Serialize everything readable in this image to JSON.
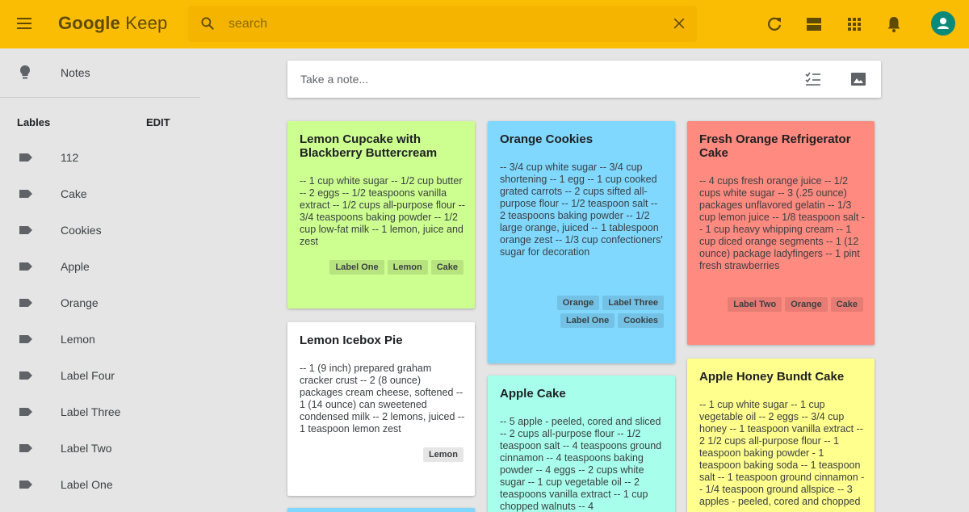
{
  "app": {
    "logo_strong": "Google",
    "logo_rest": " Keep"
  },
  "search": {
    "placeholder": "search"
  },
  "header_icons": [
    "menu-icon",
    "search-icon",
    "close-icon",
    "refresh-icon",
    "list-view-icon",
    "apps-icon",
    "bell-icon",
    "account-icon"
  ],
  "sidebar": {
    "notes_label": "Notes",
    "labels_heading": "Lables",
    "edit_label": "EDIT",
    "labels": [
      "112",
      "Cake",
      "Cookies",
      "Apple",
      "Orange",
      "Lemon",
      "Label Four",
      "Label Three",
      "Label Two",
      "Label One"
    ]
  },
  "take_note": {
    "placeholder": "Take a note..."
  },
  "colors": {
    "header": "#fbbc04",
    "green": "#ccff90",
    "blue": "#80d8ff",
    "red": "#ff8a80",
    "white": "#ffffff",
    "teal": "#a7ffeb",
    "yellow": "#ffff8d"
  },
  "notes": [
    {
      "title": "Lemon Cupcake with Blackberry Buttercream",
      "body": "-- 1 cup white sugar -- 1/2 cup butter -- 2 eggs -- 1/2 teaspoons vanilla extract -- 1/2 cups all-purpose flour -- 3/4 teaspoons baking powder -- 1/2 cup low-fat milk -- 1 lemon, juice and zest",
      "labels": [
        "Label One",
        "Lemon",
        "Cake"
      ]
    },
    {
      "title": "Lemon Icebox Pie",
      "body": "-- 1 (9 inch) prepared graham cracker crust -- 2 (8 ounce) packages cream cheese, softened -- 1 (14 ounce) can sweetened condensed milk -- 2 lemons, juiced -- 1 teaspoon lemon zest",
      "labels": [
        "Lemon"
      ]
    },
    {
      "title": "Orange Cookies",
      "body": "-- 3/4 cup white sugar -- 3/4 cup shortening -- 1 egg -- 1 cup cooked grated carrots -- 2 cups sifted all-purpose flour -- 1/2 teaspoon salt -- 2 teaspoons baking powder -- 1/2 large orange, juiced -- 1 tablespoon orange zest -- 1/3 cup confectioners' sugar for decoration",
      "labels": [
        "Orange",
        "Label Three",
        "Label One",
        "Cookies"
      ]
    },
    {
      "title": "Apple Cake",
      "body": "-- 5 apple - peeled, cored and sliced -- 2 cups all-purpose flour -- 1/2 teaspoon salt -- 4 teaspoons ground cinnamon -- 4 teaspoons baking powder -- 4 eggs -- 2 cups white sugar -- 1 cup vegetable oil -- 2 teaspoons vanilla extract -- 1 cup chopped walnuts -- 4",
      "labels": []
    },
    {
      "title": "Fresh Orange Refrigerator Cake",
      "body": "-- 4 cups fresh orange juice -- 1/2 cups white sugar -- 3 (.25 ounce) packages unflavored gelatin -- 1/3 cup lemon juice -- 1/8 teaspoon salt -- 1 cup heavy whipping cream -- 1 cup diced orange segments -- 1 (12 ounce) package ladyfingers -- 1 pint fresh strawberries",
      "labels": [
        "Label Two",
        "Orange",
        "Cake"
      ]
    },
    {
      "title": "Apple Honey Bundt Cake",
      "body": "-- 1 cup white sugar -- 1 cup vegetable oil -- 2 eggs -- 3/4 cup honey -- 1 teaspoon vanilla extract -- 2 1/2 cups all-purpose flour -- 1 teaspoon baking powder - 1 teaspoon baking soda -- 1 teaspoon salt -- 1 teaspoon ground cinnamon -- 1/4 teaspoon ground allspice -- 3 apples - peeled, cored and chopped",
      "labels": []
    },
    {
      "title": "",
      "body": "",
      "labels": []
    }
  ]
}
